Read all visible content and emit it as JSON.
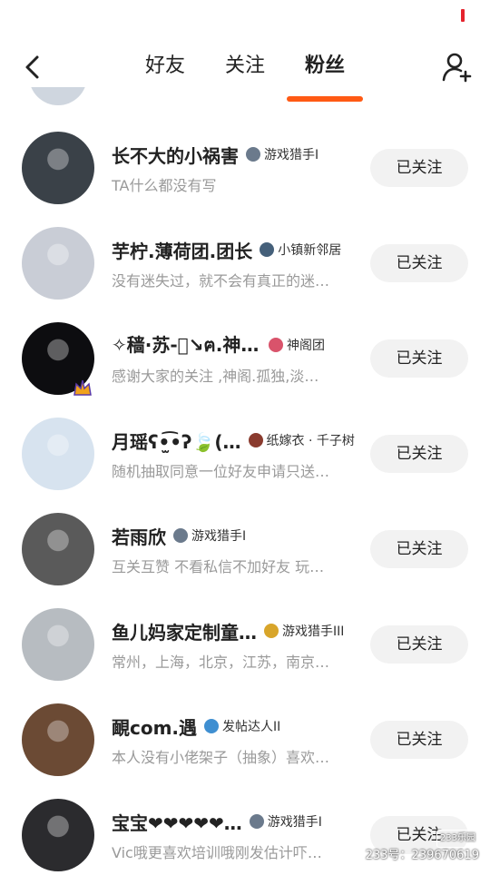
{
  "tabs": [
    {
      "label": "好友",
      "active": false
    },
    {
      "label": "关注",
      "active": false
    },
    {
      "label": "粉丝",
      "active": true
    }
  ],
  "accent_color": "#ff5a14",
  "back_icon": "chevron-left-icon",
  "add_friend_icon": "add-user-icon",
  "followers": [
    {
      "name": "长不大的小祸害",
      "badge": "游戏猎手I",
      "bio": "TA什么都没有写",
      "button": "已关注",
      "avatar_color": "#3a4148",
      "badge_color": "#6b7a8c"
    },
    {
      "name": "芋柠.薄荷团.团长",
      "badge": "小镇新邻居",
      "bio": "没有迷失过，就不会有真正的迷…",
      "button": "已关注",
      "avatar_color": "#c9cdd6",
      "badge_color": "#45607a"
    },
    {
      "name": "✧穑·苏-⃢↘ฅ.神阁.",
      "badge": "神阁团",
      "bio": "感谢大家的关注 ,神阁.孤独,淡…",
      "button": "已关注",
      "avatar_color": "#0d0d10",
      "badge_color": "#d9536b"
    },
    {
      "name": "月瑶ʕ•̫͡•ʔ🍃(…",
      "badge": "纸嫁衣 · 千子树",
      "bio": "随机抽取同意一位好友申请只送…",
      "button": "已关注",
      "avatar_color": "#d7e3ef",
      "badge_color": "#8a3b2e"
    },
    {
      "name": "若雨欣",
      "badge": "游戏猎手I",
      "bio": "互关互赞 不看私信不加好友 玩…",
      "button": "已关注",
      "avatar_color": "#5a5a5a",
      "badge_color": "#6b7a8c"
    },
    {
      "name": "鱼儿妈家定制童…",
      "badge": "游戏猎手III",
      "bio": "常州，上海，北京，江苏，南京…",
      "button": "已关注",
      "avatar_color": "#b7bcc1",
      "badge_color": "#d8a52a"
    },
    {
      "name": "靦com.遇",
      "badge": "发帖达人II",
      "bio": "本人没有小佬架子（抽象）喜欢…",
      "button": "已关注",
      "avatar_color": "#6b4a34",
      "badge_color": "#3f8fd1"
    },
    {
      "name": "宝宝❤❤❤❤❤…",
      "badge": "游戏猎手I",
      "bio": "Vic哦更喜欢培训哦刚发估计吓…",
      "button": "已关注",
      "avatar_color": "#2b2b2e",
      "badge_color": "#6b7a8c"
    }
  ],
  "watermark": {
    "logo": "233乐园",
    "text": "233号：239670619"
  }
}
